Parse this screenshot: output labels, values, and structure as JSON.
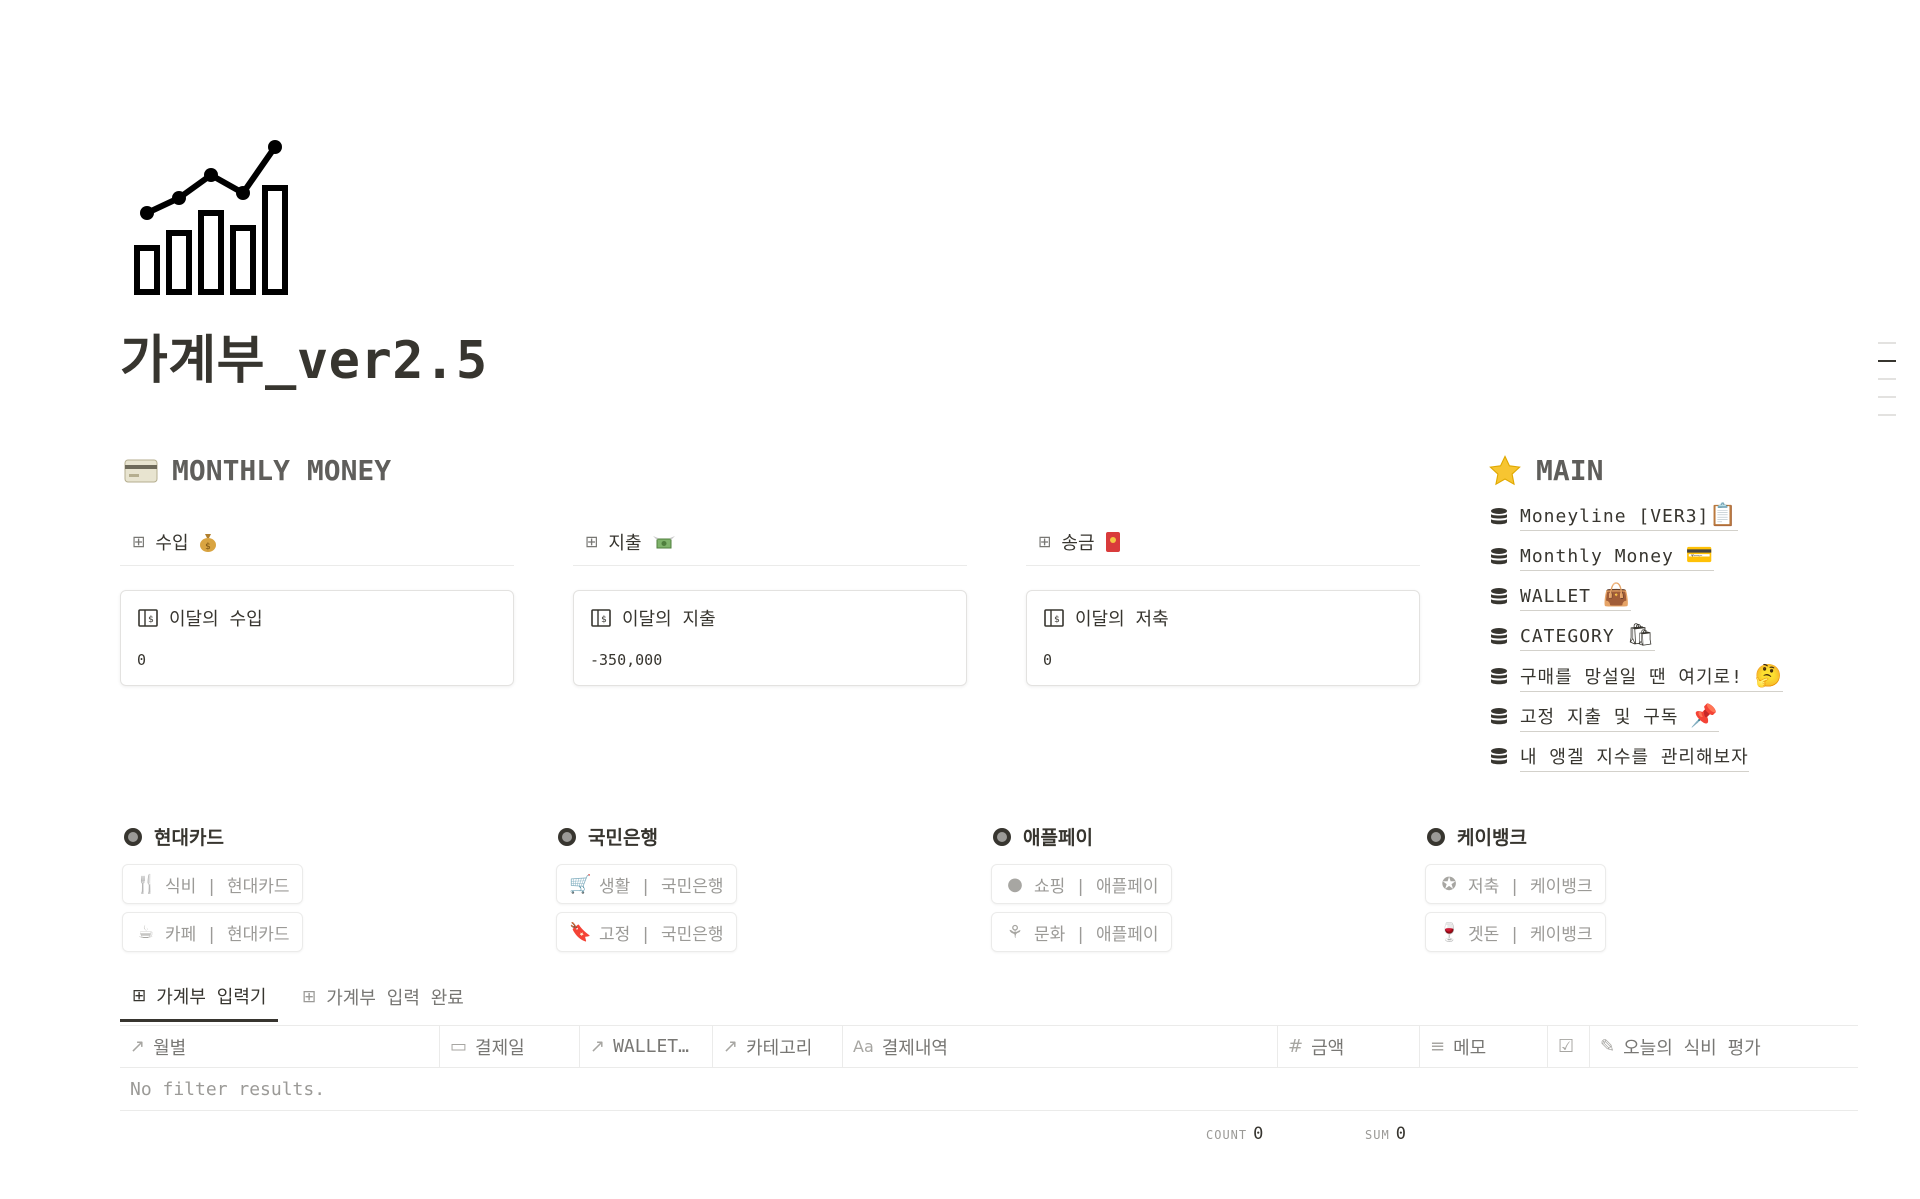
{
  "page": {
    "title": "가계부_ver2.5",
    "icon": "chart-bars-line-icon"
  },
  "monthly": {
    "heading": "MONTHLY MONEY",
    "heading_icon": "credit-card-icon",
    "columns": [
      {
        "tab_label": "수입",
        "tab_icon": "money-bag-icon",
        "card_title": "이달의 수입",
        "value": "0"
      },
      {
        "tab_label": "지출",
        "tab_icon": "money-wings-icon",
        "card_title": "이달의 지출",
        "value": "-350,000"
      },
      {
        "tab_label": "송금",
        "tab_icon": "red-envelope-icon",
        "card_title": "이달의 저축",
        "value": "0"
      }
    ]
  },
  "main": {
    "heading": "MAIN",
    "heading_icon": "star-icon",
    "links": [
      {
        "label": "Moneyline [VER3]",
        "emoji": "📋"
      },
      {
        "label": "Monthly Money",
        "emoji": "💳"
      },
      {
        "label": "WALLET",
        "emoji": "👜"
      },
      {
        "label": "CATEGORY",
        "emoji": "🛍"
      },
      {
        "label": "구매를 망설일 땐 여기로!",
        "emoji": "🤔"
      },
      {
        "label": "고정 지출 및 구독",
        "emoji": "📌"
      },
      {
        "label": "내 앵겔 지수를 관리해보자",
        "emoji": ""
      }
    ]
  },
  "banks": [
    {
      "name": "현대카드",
      "chips": [
        {
          "icon": "utensils-icon",
          "text": "식비  |  현대카드"
        },
        {
          "icon": "coffee-cup-icon",
          "text": "카페  |  현대카드"
        }
      ]
    },
    {
      "name": "국민은행",
      "chips": [
        {
          "icon": "shopping-cart-icon",
          "text": "생활  |  국민은행"
        },
        {
          "icon": "bookmark-icon",
          "text": "고정  |  국민은행"
        }
      ]
    },
    {
      "name": "애플페이",
      "chips": [
        {
          "icon": "apple-icon",
          "text": "쇼핑  |  애플페이"
        },
        {
          "icon": "palm-tree-icon",
          "text": "문화  |  애플페이"
        }
      ]
    },
    {
      "name": "케이뱅크",
      "chips": [
        {
          "icon": "star-badge-icon",
          "text": "저축  |  케이뱅크"
        },
        {
          "icon": "wine-bottle-icon",
          "text": "겟돈  |  케이뱅크"
        }
      ]
    }
  ],
  "database": {
    "tabs": [
      {
        "label": "가계부 입력기",
        "active": true
      },
      {
        "label": "가계부 입력 완료",
        "active": false
      }
    ],
    "columns": [
      {
        "icon": "relation-arrow-icon",
        "label": "월별"
      },
      {
        "icon": "calendar-icon",
        "label": "결제일"
      },
      {
        "icon": "relation-arrow-icon",
        "label": "WALLET…"
      },
      {
        "icon": "relation-arrow-icon",
        "label": "카테고리"
      },
      {
        "icon": "text-aa-icon",
        "label": "결제내역"
      },
      {
        "icon": "number-hash-icon",
        "label": "금액"
      },
      {
        "icon": "text-lines-icon",
        "label": "메모"
      },
      {
        "icon": "checkbox-icon",
        "label": ""
      },
      {
        "icon": "pencil-icon",
        "label": "오늘의 식비 평가"
      }
    ],
    "empty_text": "No filter results.",
    "footer": {
      "count_label": "COUNT",
      "count_value": "0",
      "sum_label": "SUM",
      "sum_value": "0"
    }
  }
}
